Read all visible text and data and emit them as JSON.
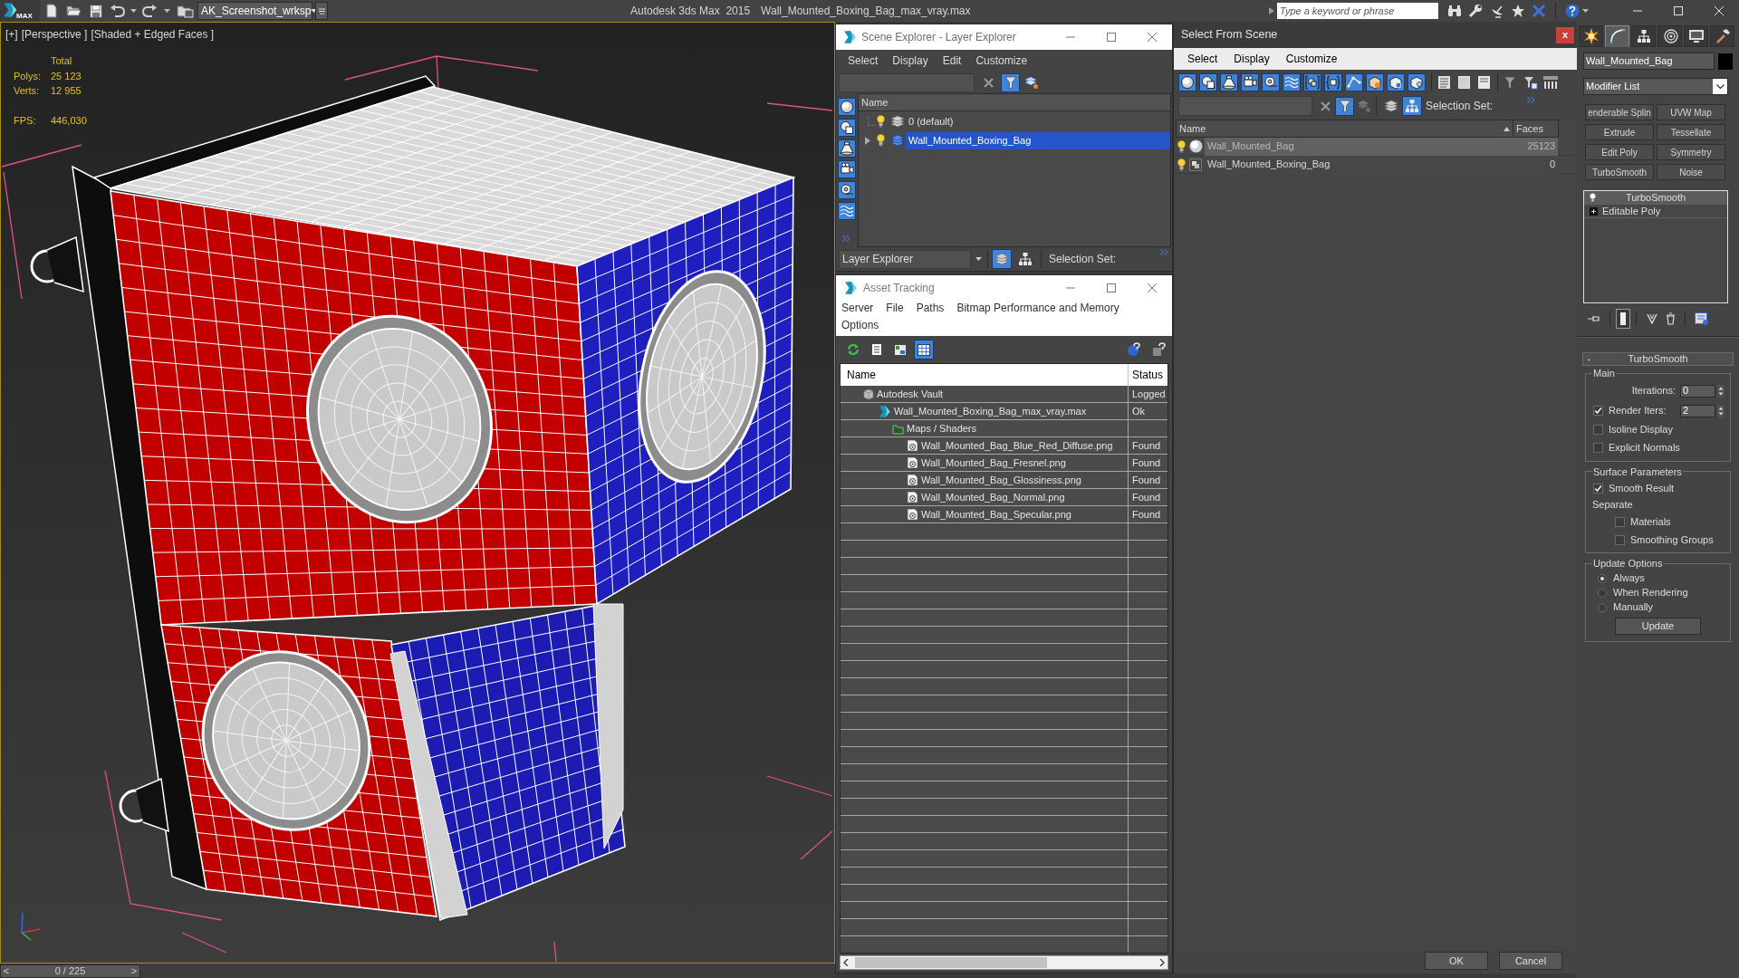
{
  "title_bar": {
    "logo": "MAX",
    "workspace": "AK_Screenshot_wrksp",
    "app_title": "Autodesk 3ds Max  2015",
    "file_name": "Wall_Mounted_Boxing_Bag_max_vray.max",
    "search": {
      "placeholder": "Type a keyword or phrase"
    }
  },
  "viewport": {
    "labels": [
      "[+]",
      "[Perspective ]",
      "[Shaded + Edged Faces ]"
    ],
    "stats_heading": "Total",
    "stats": [
      {
        "label": "Polys:",
        "value": "25 123"
      },
      {
        "label": "Verts:",
        "value": "12 955"
      }
    ],
    "fps": {
      "label": "FPS:",
      "value": "446,030"
    }
  },
  "time_slider": {
    "previous": "<",
    "frame": "0 / 225",
    "next": ">",
    "level": 0
  },
  "scene_explorer": {
    "title": "Scene Explorer - Layer Explorer",
    "menu": [
      "Select",
      "Display",
      "Edit",
      "Customize"
    ],
    "filter_button": {
      "on": true
    },
    "display_filters": [
      {
        "on": true
      },
      {
        "on": true
      },
      {
        "on": true
      },
      {
        "on": true
      },
      {
        "on": true
      },
      {
        "on": true
      }
    ],
    "column": "Name",
    "layers": [
      {
        "kind": "leaf",
        "name": "0 (default)",
        "selected": false
      },
      {
        "kind": "branch",
        "name": "Wall_Mounted_Boxing_Bag",
        "selected": true
      }
    ],
    "explorer_mode": "Layer Explorer",
    "mode_buttons": [
      {
        "on": true
      },
      {
        "on": false
      }
    ],
    "selection_set_label": "Selection Set:"
  },
  "asset_tracking": {
    "title": "Asset Tracking",
    "menu": [
      "Server",
      "File",
      "Paths",
      "Bitmap Performance and Memory",
      "Options"
    ],
    "toolbar_buttons": [
      {
        "on": false
      },
      {
        "on": false
      },
      {
        "on": false
      },
      {
        "on": true
      }
    ],
    "columns": [
      "Name",
      "Status"
    ],
    "assets": [
      {
        "kind": "vault",
        "name": "Autodesk Vault",
        "status": "Logged",
        "children": [
          {
            "kind": "scene_file",
            "name": "Wall_Mounted_Boxing_Bag_max_vray.max",
            "status": "Ok",
            "children": [
              {
                "kind": "folder",
                "name": "Maps / Shaders",
                "children": [
                  {
                    "kind": "bitmap",
                    "name": "Wall_Mounted_Bag_Blue_Red_Diffuse.png",
                    "status": "Found"
                  },
                  {
                    "kind": "bitmap",
                    "name": "Wall_Mounted_Bag_Fresnel.png",
                    "status": "Found"
                  },
                  {
                    "kind": "bitmap",
                    "name": "Wall_Mounted_Bag_Glossiness.png",
                    "status": "Found"
                  },
                  {
                    "kind": "bitmap",
                    "name": "Wall_Mounted_Bag_Normal.png",
                    "status": "Found"
                  },
                  {
                    "kind": "bitmap",
                    "name": "Wall_Mounted_Bag_Specular.png",
                    "status": "Found"
                  }
                ]
              }
            ]
          }
        ]
      }
    ]
  },
  "select_from_scene": {
    "title": "Select From Scene",
    "close": "x",
    "menu": [
      "Select",
      "Display",
      "Customize"
    ],
    "display_filters": [
      {
        "on": true
      },
      {
        "on": true
      },
      {
        "on": true
      },
      {
        "on": true
      },
      {
        "on": true
      },
      {
        "on": true
      },
      {
        "on": true
      },
      {
        "on": true
      },
      {
        "on": true
      },
      {
        "on": true
      },
      {
        "on": true
      },
      {
        "on": true
      }
    ],
    "filter_button": {
      "on": true
    },
    "hierarchy_button": {
      "on": true
    },
    "selection_set_label": "Selection Set:",
    "columns": [
      "Name",
      "Faces"
    ],
    "objects": [
      {
        "kind": "geometry",
        "name": "Wall_Mounted_Bag",
        "faces": "25123",
        "selected": true
      },
      {
        "kind": "group",
        "name": "Wall_Mounted_Boxing_Bag",
        "faces": "0",
        "selected": false
      }
    ],
    "buttons": [
      "OK",
      "Cancel"
    ]
  },
  "command_panel": {
    "tabs": [
      {
        "selected": false
      },
      {
        "selected": true
      },
      {
        "selected": false
      },
      {
        "selected": false
      },
      {
        "selected": false
      },
      {
        "selected": false
      }
    ],
    "object_name": "Wall_Mounted_Bag",
    "modifier_list": "Modifier List",
    "modifier_buttons": [
      "enderable Splin",
      "UVW Map",
      "Extrude",
      "Tessellate",
      "Edit Poly",
      "Symmetry",
      "TurboSmooth",
      "Noise"
    ],
    "stack": [
      {
        "kind": "modifier",
        "name": "TurboSmooth",
        "selected": true
      },
      {
        "kind": "base_object",
        "name": "Editable Poly",
        "selected": false
      }
    ],
    "stack_tools": [
      {
        "on": false
      },
      {
        "on": true
      },
      {
        "on": false
      },
      {
        "on": false
      },
      {
        "on": false
      }
    ],
    "rollout": {
      "toggle": "-",
      "title": "TurboSmooth",
      "groups": [
        {
          "title": "Main",
          "controls": [
            {
              "kind": "spinner",
              "label": "Iterations:",
              "value": "0"
            },
            {
              "kind": "checkspinner",
              "label": "Render Iters:",
              "checked": true,
              "value": "2"
            },
            {
              "kind": "checkbox",
              "label": "Isoline Display",
              "checked": false
            },
            {
              "kind": "checkbox",
              "label": "Explicit Normals",
              "checked": false
            }
          ]
        },
        {
          "title": "Surface Parameters",
          "controls": [
            {
              "kind": "checkbox",
              "label": "Smooth Result",
              "checked": true
            },
            {
              "kind": "label",
              "label": "Separate",
              "children": [
                {
                  "kind": "checkbox",
                  "label": "Materials",
                  "checked": false
                },
                {
                  "kind": "checkbox",
                  "label": "Smoothing Groups",
                  "checked": false
                }
              ]
            }
          ]
        },
        {
          "title": "Update Options",
          "controls": [
            {
              "kind": "radio",
              "label": "Always",
              "selected": true
            },
            {
              "kind": "radio",
              "label": "When Rendering",
              "selected": false
            },
            {
              "kind": "radio",
              "label": "Manually",
              "selected": false
            },
            {
              "kind": "button",
              "label": "Update"
            }
          ]
        }
      ]
    }
  }
}
